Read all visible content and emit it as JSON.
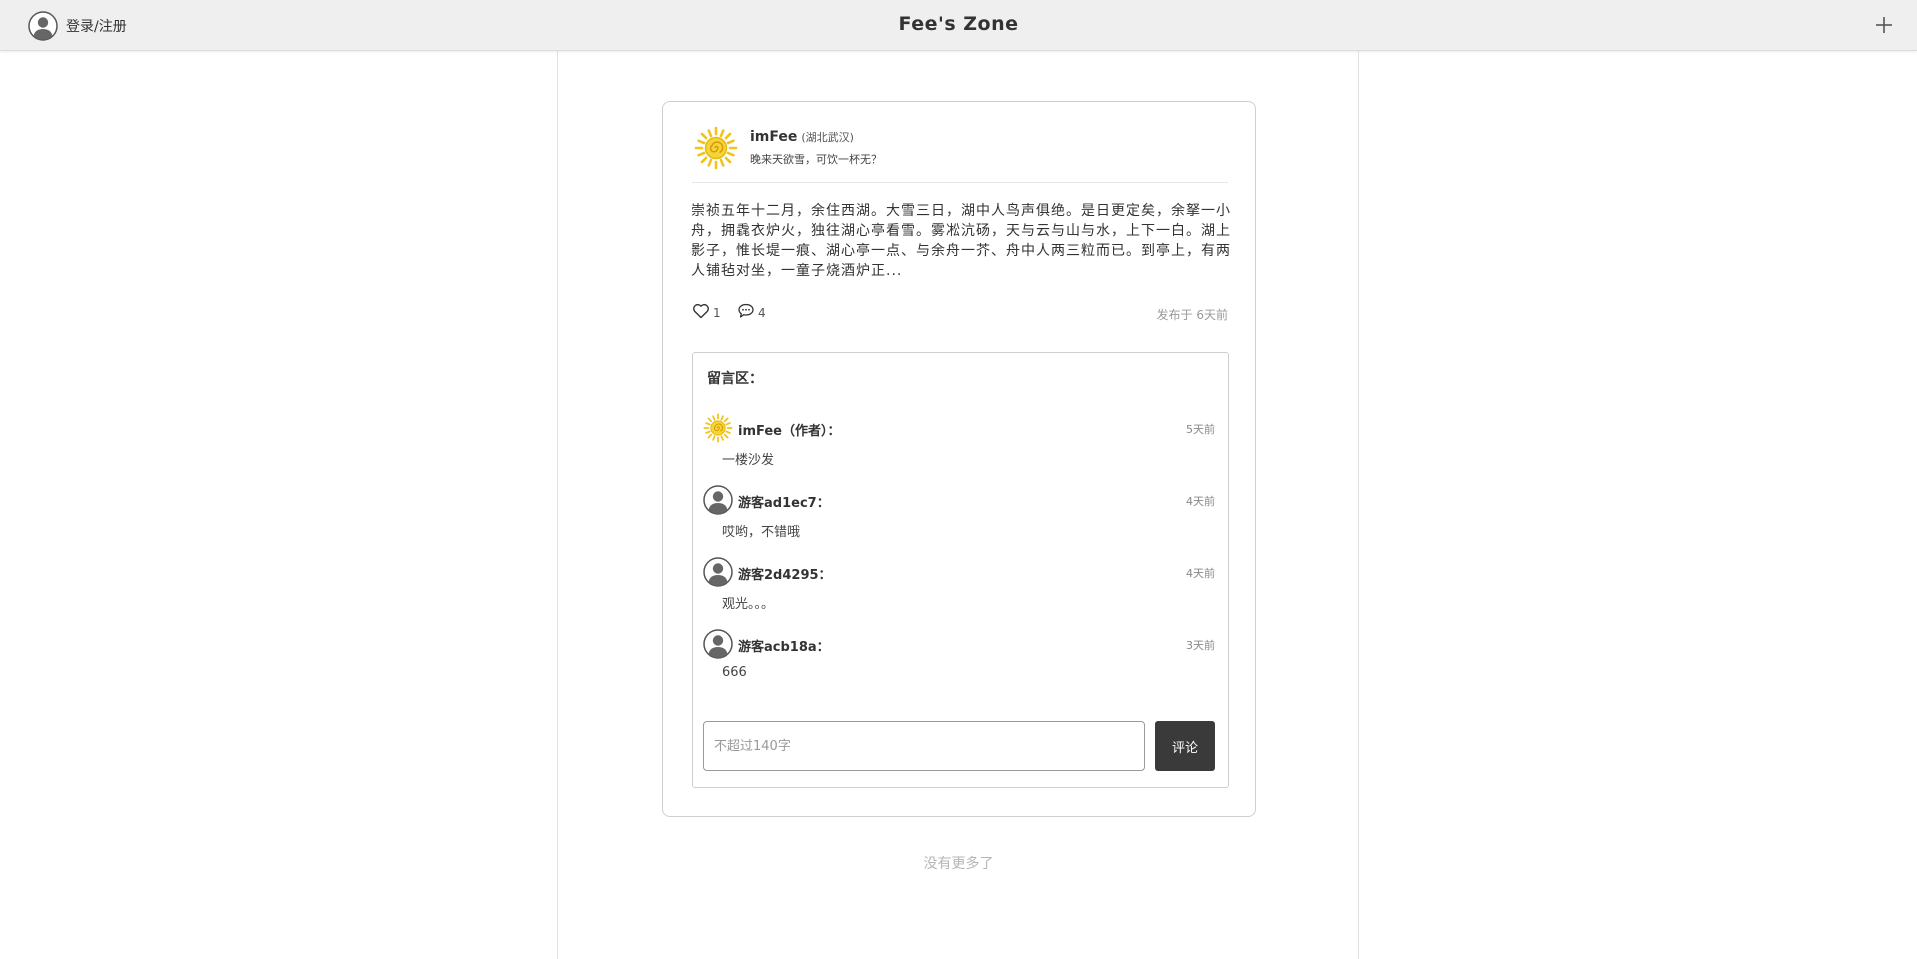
{
  "header": {
    "login_label": "登录/注册",
    "site_title": "Fee's  Zone",
    "add_icon": "plus-icon"
  },
  "post": {
    "author": "imFee",
    "location": "(湖北武汉)",
    "signature": "晚来天欲雪，可饮一杯无？",
    "body": "崇祯五年十二月，余住西湖。大雪三日，湖中人鸟声俱绝。是日更定矣，余拏一小舟，拥毳衣炉火，独往湖心亭看雪。雾凇沆砀，天与云与山与水，上下一白。湖上影子，惟长堤一痕、湖心亭一点、与余舟一芥、舟中人两三粒而已。到亭上，有两人铺毡对坐，一童子烧酒炉正...",
    "likes": "1",
    "comments": "4",
    "posted": "发布于 6天前"
  },
  "comment_section": {
    "title": "留言区：",
    "items": [
      {
        "name": "imFee（作者）：",
        "time": "5天前",
        "text": "一楼沙发",
        "avatar": "sun-icon"
      },
      {
        "name": "游客ad1ec7：",
        "time": "4天前",
        "text": "哎哟，不错哦",
        "avatar": "user-avatar-icon"
      },
      {
        "name": "游客2d4295：",
        "time": "4天前",
        "text": "观光。。。",
        "avatar": "user-avatar-icon"
      },
      {
        "name": "游客acb18a：",
        "time": "3天前",
        "text": "666",
        "avatar": "user-avatar-icon"
      }
    ],
    "input_placeholder": "不超过140字",
    "submit_label": "评论"
  },
  "footer": {
    "no_more": "没有更多了"
  },
  "colors": {
    "topbar_bg": "#efefef",
    "button_bg": "#3a3a3a",
    "sun_yellow": "#f2c419"
  }
}
